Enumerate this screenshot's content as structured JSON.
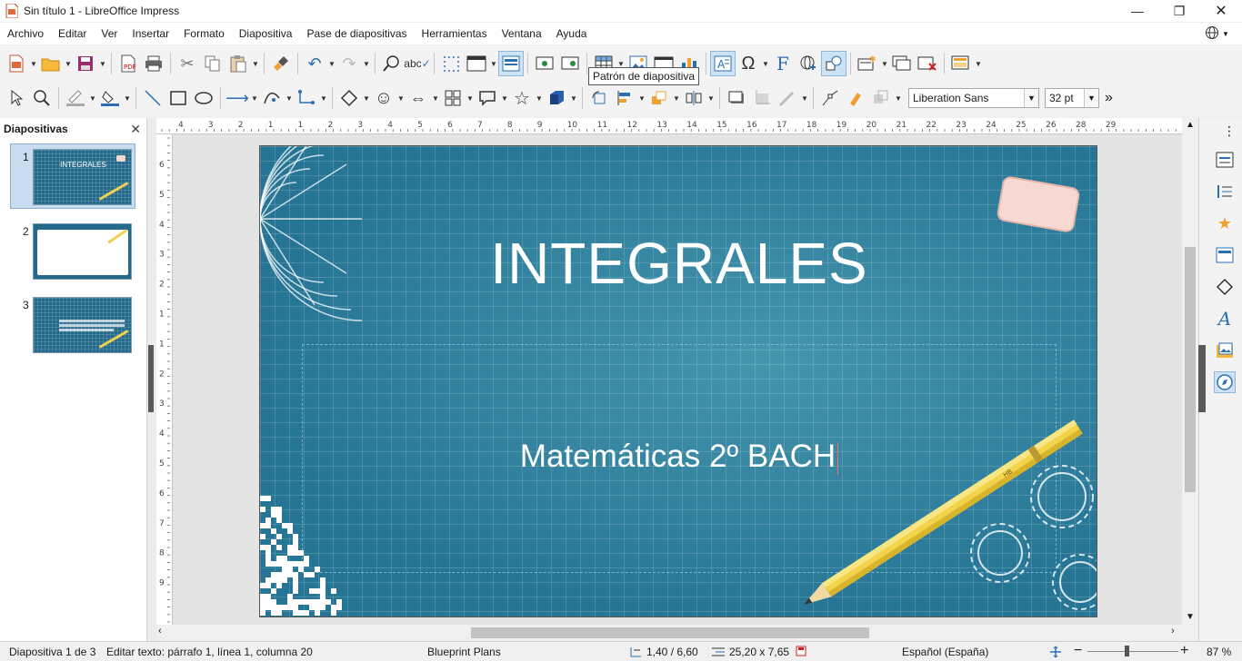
{
  "window": {
    "title": "Sin título 1 - LibreOffice Impress"
  },
  "menu": [
    "Archivo",
    "Editar",
    "Ver",
    "Insertar",
    "Formato",
    "Diapositiva",
    "Pase de diapositivas",
    "Herramientas",
    "Ventana",
    "Ayuda"
  ],
  "tooltip": "Patrón de diapositiva",
  "font": {
    "name": "Liberation Sans",
    "size": "32 pt"
  },
  "panel": {
    "title": "Diapositivas",
    "slides": [
      {
        "number": "1",
        "label": "INTEGRALES",
        "selected": true
      },
      {
        "number": "2",
        "label": "",
        "selected": false
      },
      {
        "number": "3",
        "label": "",
        "selected": false
      }
    ]
  },
  "slide": {
    "title": "INTEGRALES",
    "subtitle": "Matemáticas 2º BACH",
    "pencil_label": "HB"
  },
  "ruler": {
    "h_ticks": [
      "4",
      "3",
      "2",
      "1",
      "1",
      "2",
      "3",
      "4",
      "5",
      "6",
      "7",
      "8",
      "9",
      "10",
      "11",
      "12",
      "13",
      "14",
      "15",
      "16",
      "17",
      "18",
      "19",
      "20",
      "21",
      "22",
      "23",
      "24",
      "25",
      "26",
      "28",
      "29"
    ],
    "v_ticks": [
      "6",
      "5",
      "4",
      "3",
      "2",
      "1",
      "1",
      "2",
      "3",
      "4",
      "5",
      "6",
      "7",
      "8",
      "9"
    ]
  },
  "status": {
    "slide": "Diapositiva 1 de 3",
    "edit": "Editar texto: párrafo 1, línea 1, columna 20",
    "master": "Blueprint Plans",
    "position": "1,40 / 6,60",
    "size": "25,20 x 7,65",
    "language": "Español (España)",
    "zoom": "87 %"
  },
  "colors": {
    "slide_bg": "#2a7a9a",
    "accent": "#2a6fb5",
    "toolbar_bg": "#f3f3f3"
  }
}
